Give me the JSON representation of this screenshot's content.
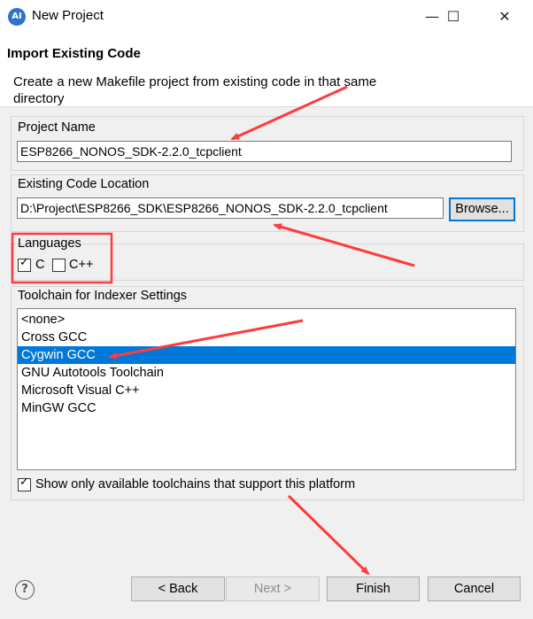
{
  "window": {
    "title": "New Project",
    "logo_text": "AI",
    "minimize_glyph": "—",
    "maximize_glyph": "☐",
    "close_glyph": "✕"
  },
  "header": {
    "title": "Import Existing Code",
    "description": "Create a new Makefile project from existing code in that same directory"
  },
  "project_name": {
    "label": "Project Name",
    "value": "ESP8266_NONOS_SDK-2.2.0_tcpclient"
  },
  "code_location": {
    "label": "Existing Code Location",
    "value": "D:\\Project\\ESP8266_SDK\\ESP8266_NONOS_SDK-2.2.0_tcpclient",
    "browse_label": "Browse..."
  },
  "languages": {
    "label": "Languages",
    "items": [
      {
        "label": "C",
        "checked": true
      },
      {
        "label": "C++",
        "checked": false
      }
    ]
  },
  "toolchain": {
    "label": "Toolchain for Indexer Settings",
    "items": [
      "<none>",
      "Cross GCC",
      "Cygwin GCC",
      "GNU Autotools Toolchain",
      "Microsoft Visual C++",
      "MinGW GCC"
    ],
    "selected_index": 2,
    "filter_label": "Show only available toolchains that support this platform",
    "filter_checked": true
  },
  "footer": {
    "help_glyph": "?",
    "back_label": "< Back",
    "next_label": "Next >",
    "finish_label": "Finish",
    "cancel_label": "Cancel"
  },
  "colors": {
    "selection": "#0078d7",
    "annotation": "#ff3b3b"
  },
  "icons": [
    "app-logo-icon",
    "minimize-icon",
    "maximize-icon",
    "close-icon",
    "checkbox-check-icon",
    "help-icon"
  ]
}
